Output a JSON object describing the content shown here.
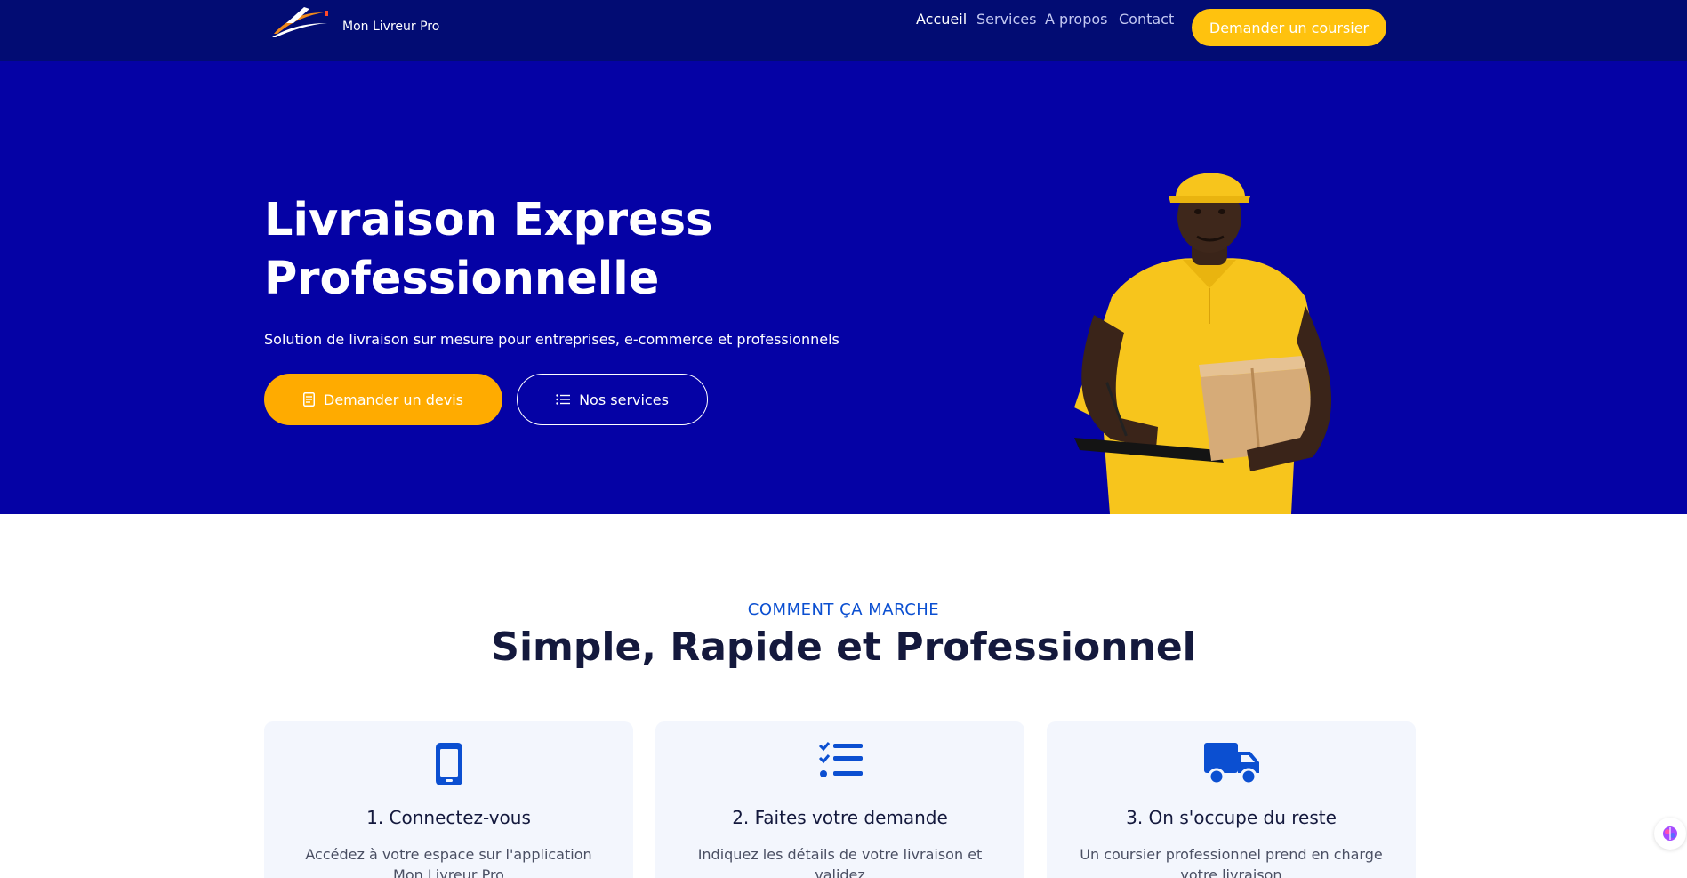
{
  "header": {
    "brand": "Mon Livreur Pro",
    "nav": [
      {
        "label": "Accueil",
        "active": true
      },
      {
        "label": "Services",
        "active": false
      },
      {
        "label": "A propos",
        "active": false
      },
      {
        "label": "Contact",
        "active": false
      }
    ],
    "cta_label": "Demander un coursier"
  },
  "hero": {
    "title_line1": "Livraison Express",
    "title_line2": "Professionnelle",
    "subtitle": "Solution de livraison sur mesure pour entreprises, e-commerce et professionnels",
    "primary_button": {
      "label": "Demander un devis",
      "icon": "document-icon"
    },
    "secondary_button": {
      "label": "Nos services",
      "icon": "list-icon"
    }
  },
  "how_it_works": {
    "eyebrow": "COMMENT ÇA MARCHE",
    "title": "Simple, Rapide et Professionnel",
    "steps": [
      {
        "icon": "smartphone-icon",
        "title": "1. Connectez-vous",
        "text": "Accédez à votre espace sur l'application Mon Livreur Pro"
      },
      {
        "icon": "checklist-icon",
        "title": "2. Faites votre demande",
        "text": "Indiquez les détails de votre livraison et validez"
      },
      {
        "icon": "truck-icon",
        "title": "3. On s'occupe du reste",
        "text": "Un coursier professionnel prend en charge votre livraison"
      }
    ]
  },
  "colors": {
    "header_bg": "#020c73",
    "hero_bg": "#0502a5",
    "accent_yellow": "#ffc20e",
    "accent_orange": "#ffab00",
    "icon_blue": "#0b4fd1",
    "heading_dark": "#14193d",
    "card_bg": "#f3f6fd"
  },
  "floating_widget": {
    "icon": "assistant-icon"
  }
}
